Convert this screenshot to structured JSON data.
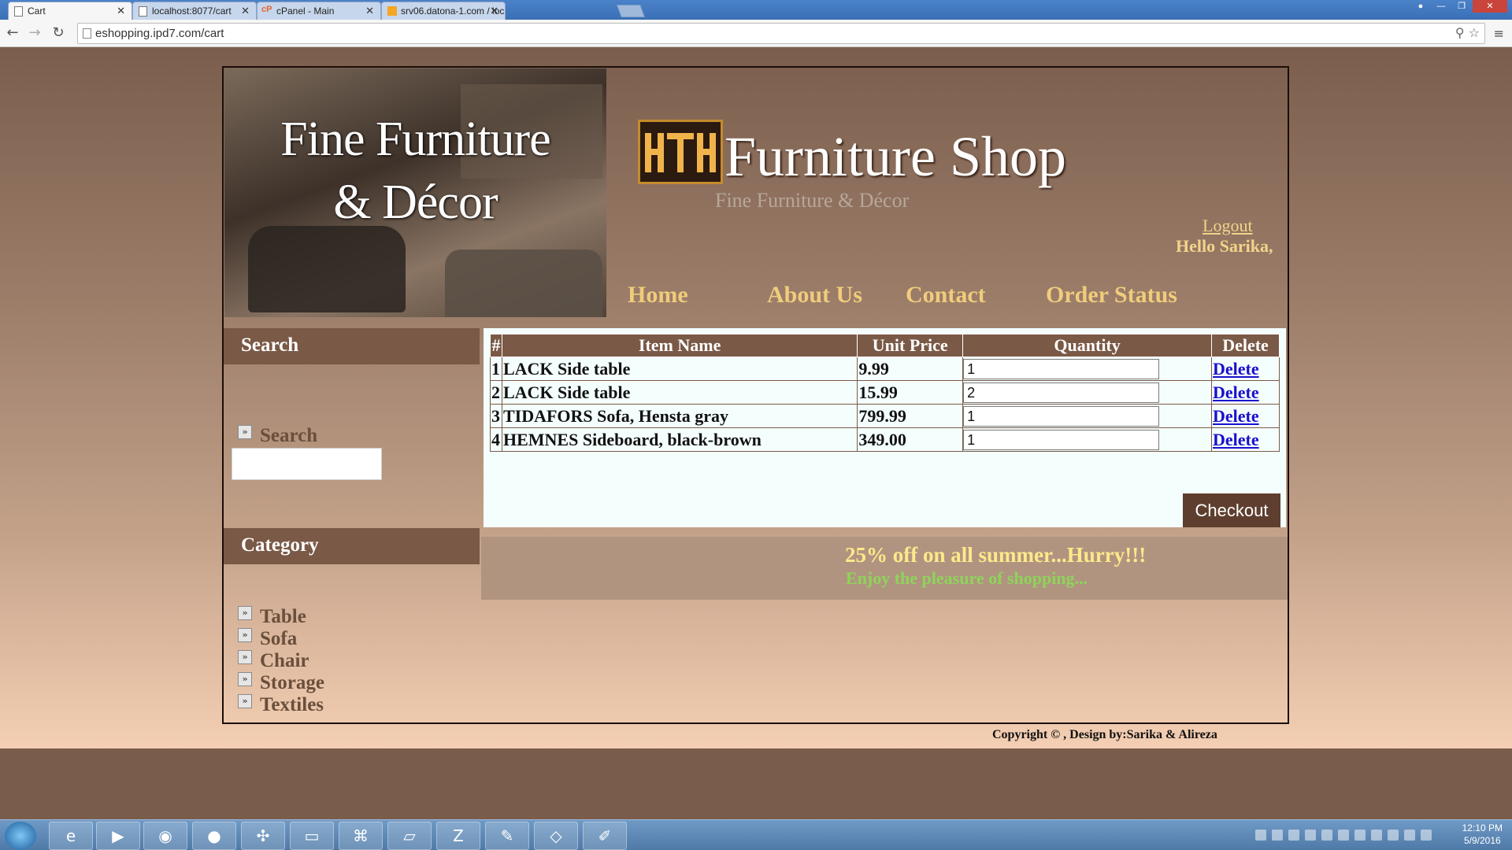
{
  "browser": {
    "tabs": [
      {
        "label": "Cart",
        "active": true
      },
      {
        "label": "localhost:8077/cart",
        "active": false
      },
      {
        "label": "cPanel - Main",
        "active": false
      },
      {
        "label": "srv06.datona-1.com / loca",
        "active": false
      }
    ],
    "url": "eshopping.ipd7.com/cart"
  },
  "header": {
    "hero_line1": "Fine Furniture",
    "hero_line2": "& Décor",
    "brand": "Furniture Shop",
    "tagline": "Fine Furniture & Décor",
    "logout": "Logout",
    "hello": "Hello Sarika,"
  },
  "nav": [
    "Home",
    "About Us",
    "Contact",
    "Order Status"
  ],
  "sidebar": {
    "search_heading": "Search",
    "search_label": "Search",
    "search_value": "",
    "category_heading": "Category",
    "categories": [
      "Table",
      "Sofa",
      "Chair",
      "Storage",
      "Textiles"
    ]
  },
  "cart": {
    "columns": [
      "#",
      "Item Name",
      "Unit Price",
      "Quantity",
      "Delete"
    ],
    "rows": [
      {
        "num": "1",
        "name": "LACK Side table",
        "price": "9.99",
        "qty": "1",
        "delete": "Delete"
      },
      {
        "num": "2",
        "name": "LACK Side table",
        "price": "15.99",
        "qty": "2",
        "delete": "Delete"
      },
      {
        "num": "3",
        "name": "TIDAFORS Sofa, Hensta gray",
        "price": "799.99",
        "qty": "1",
        "delete": "Delete"
      },
      {
        "num": "4",
        "name": "HEMNES Sideboard, black-brown",
        "price": "349.00",
        "qty": "1",
        "delete": "Delete"
      }
    ],
    "checkout": "Checkout"
  },
  "promo": {
    "line1": "25% off on all summer...Hurry!!!",
    "line2": "Enjoy the pleasure of shopping..."
  },
  "footer": {
    "copyright": "Copyright © , Design by:Sarika & Alireza"
  },
  "taskbar": {
    "time": "12:10 PM",
    "date": "5/9/2016"
  },
  "colors": {
    "accent_brown": "#7a5946",
    "nav_gold": "#f0cc7c",
    "promo_yellow": "#fde98a",
    "promo_green": "#8ed45a"
  }
}
